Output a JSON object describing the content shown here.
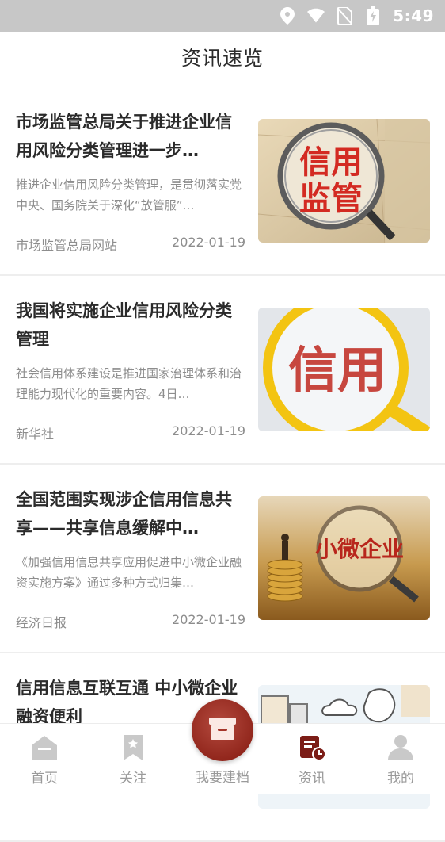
{
  "status_bar": {
    "time": "5:49",
    "icons": [
      "location-icon",
      "wifi-icon",
      "no-sim-icon",
      "battery-charging-icon"
    ]
  },
  "header": {
    "title": "资讯速览"
  },
  "news": [
    {
      "headline": "市场监管总局关于推进企业信用风险分类管理进一步…",
      "summary": "推进企业信用风险分类管理，是贯彻落实党中央、国务院关于深化“放管服”…",
      "source": "市场监管总局网站",
      "date": "2022-01-19",
      "thumb_text": [
        "信用",
        "监管"
      ]
    },
    {
      "headline": "我国将实施企业信用风险分类管理",
      "summary": "社会信用体系建设是推进国家治理体系和治理能力现代化的重要内容。4日…",
      "source": "新华社",
      "date": "2022-01-19",
      "thumb_text": [
        "信用"
      ]
    },
    {
      "headline": "全国范围实现涉企信用信息共享——共享信息缓解中…",
      "summary": "《加强信用信息共享应用促进中小微企业融资实施方案》通过多种方式归集…",
      "source": "经济日报",
      "date": "2022-01-19",
      "thumb_text": [
        "小微企业"
      ]
    },
    {
      "headline": "信用信息互联互通 中小微企业融资便利",
      "summary": "",
      "source": "",
      "date": "",
      "thumb_text": []
    }
  ],
  "bottom_nav": {
    "items": [
      {
        "label": "首页",
        "icon": "home-icon",
        "active": false
      },
      {
        "label": "关注",
        "icon": "bookmark-icon",
        "active": false
      },
      {
        "label": "我要建档",
        "icon": "archive-box-icon",
        "active": false
      },
      {
        "label": "资讯",
        "icon": "news-clock-icon",
        "active": true
      },
      {
        "label": "我的",
        "icon": "person-icon",
        "active": false
      }
    ]
  },
  "colors": {
    "accent": "#7c1d17",
    "status_bar": "#c7c7c7",
    "inactive": "#9a9a9a"
  }
}
